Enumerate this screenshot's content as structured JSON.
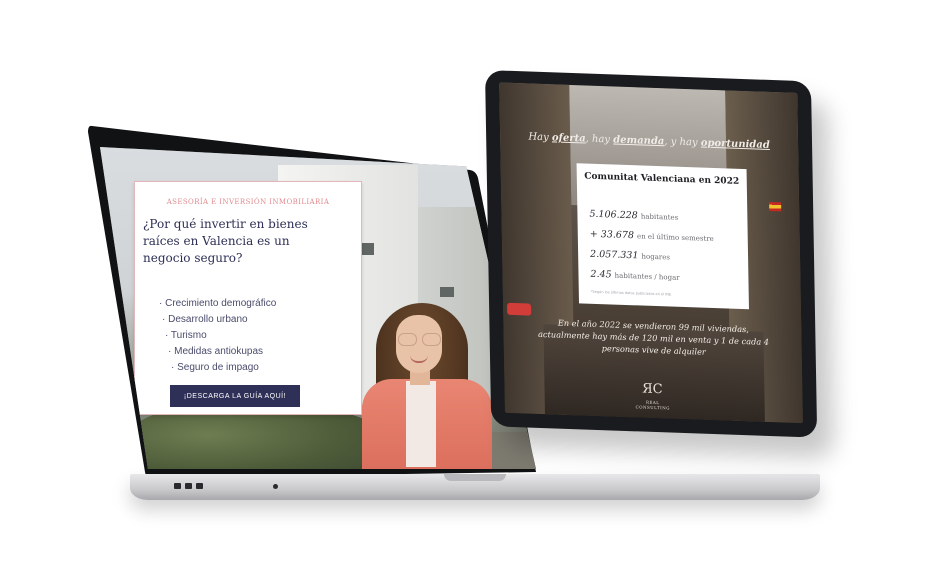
{
  "laptop": {
    "kicker": "ASESORÍA E INVERSIÓN INMOBILIARIA",
    "title": "¿Por qué invertir en bienes raíces en Valencia es un negocio seguro?",
    "reasons": [
      "· Crecimiento demográfico",
      "· Desarrollo urbano",
      "· Turismo",
      "· Medidas antiokupas",
      "· Seguro de impago"
    ],
    "cta_label": "¡DESCARGA LA GUÍA AQUÍ!",
    "accent_color": "#e08a8e",
    "button_color": "#2f3058"
  },
  "tablet": {
    "tagline_part1": "Hay ",
    "tagline_bold1": "oferta",
    "tagline_part2": ", hay ",
    "tagline_bold2": "demanda",
    "tagline_part3": ", y hay ",
    "tagline_bold3": "oportunidad",
    "card_title": "Comunitat Valenciana en 2022",
    "stats": [
      {
        "value": "5.106.228",
        "label": "habitantes"
      },
      {
        "value": "+ 33.678",
        "label": "en el último semestre"
      },
      {
        "value": "2.057.331",
        "label": "hogares"
      },
      {
        "value": "2.45",
        "label": "habitantes / hogar"
      }
    ],
    "card_footnote": "*Según los últimos datos publicados en el INE",
    "paragraph": "En el año 2022 se vendieron 99 mil viviendas, actualmente hay más de 120 mil en venta y 1 de cada 4 personas vive de alquiler",
    "logo_mark": "ЯC",
    "logo_text": "REAL CONSULTING"
  }
}
